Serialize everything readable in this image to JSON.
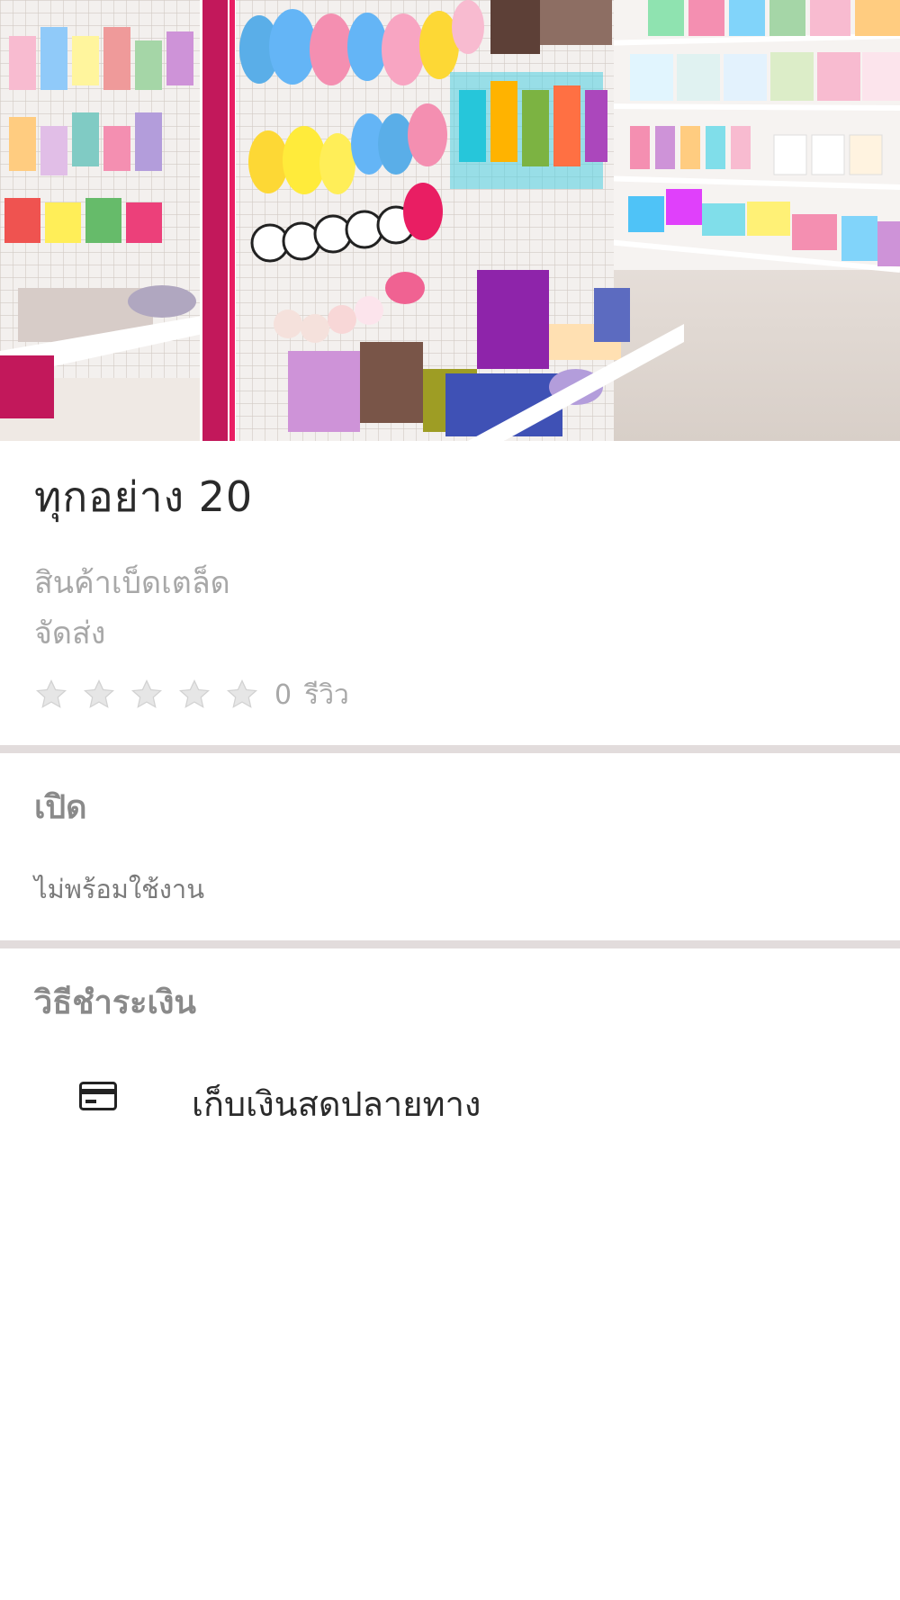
{
  "store": {
    "name": "ทุกอย่าง 20",
    "category": "สินค้าเบ็ดเตล็ด",
    "delivery": "จัดส่ง",
    "rating": 0,
    "max_rating": 5,
    "review_count": "0",
    "review_label": "รีวิว"
  },
  "hours": {
    "title": "เปิด",
    "status": "ไม่พร้อมใช้งาน"
  },
  "payment": {
    "title": "วิธีชำระเงิน",
    "methods": [
      {
        "icon": "credit-card-icon",
        "label": "เก็บเงินสดปลายทาง"
      }
    ]
  },
  "colors": {
    "title_text": "#2a2a2a",
    "muted_text": "#a8a8a8",
    "section_title": "#8a8a8a",
    "divider": "#e2dcdc",
    "star_empty": "#e6e6e6",
    "shelf_accent": "#c2185b"
  },
  "hero": {
    "icon": "store-interior-photo"
  }
}
